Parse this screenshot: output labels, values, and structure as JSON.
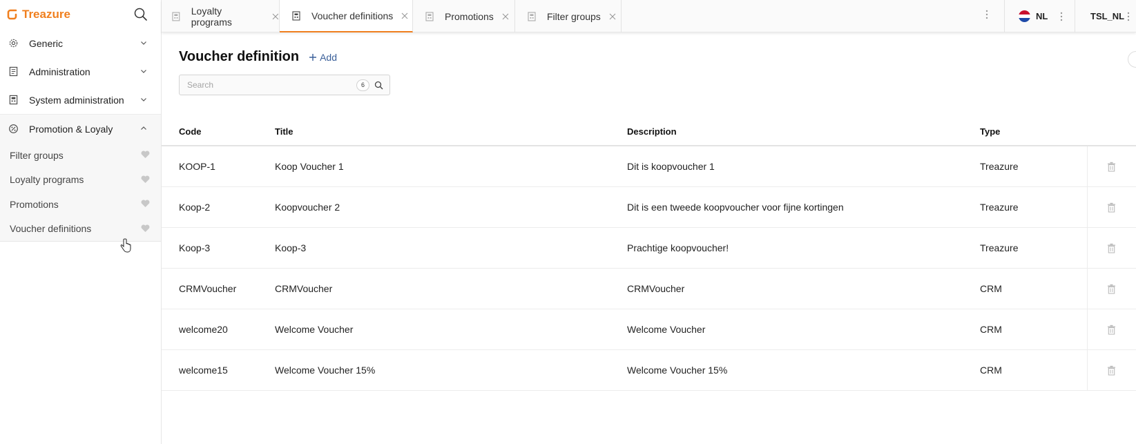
{
  "brand": {
    "name": "Treazure",
    "color": "#f07f1e"
  },
  "sidebar": {
    "items": [
      {
        "label": "Generic",
        "icon": "gear-icon"
      },
      {
        "label": "Administration",
        "icon": "document-icon"
      },
      {
        "label": "System administration",
        "icon": "calculator-icon"
      },
      {
        "label": "Promotion & Loyaly",
        "icon": "percent-badge-icon"
      }
    ],
    "subitems": [
      {
        "label": "Filter groups"
      },
      {
        "label": "Loyalty programs"
      },
      {
        "label": "Promotions"
      },
      {
        "label": "Voucher definitions"
      }
    ]
  },
  "tabs": [
    {
      "label": "Loyalty programs",
      "active": false
    },
    {
      "label": "Voucher definitions",
      "active": true
    },
    {
      "label": "Promotions",
      "active": false
    },
    {
      "label": "Filter groups",
      "active": false
    }
  ],
  "header": {
    "language": "NL",
    "user": "TSL_NL"
  },
  "main": {
    "title": "Voucher definition",
    "add_label": "Add",
    "search": {
      "placeholder": "Search",
      "value": "",
      "count": "6"
    },
    "table": {
      "columns": [
        "Code",
        "Title",
        "Description",
        "Type"
      ],
      "rows": [
        {
          "code": "KOOP-1",
          "title": "Koop Voucher 1",
          "description": "Dit is koopvoucher 1",
          "type": "Treazure"
        },
        {
          "code": "Koop-2",
          "title": "Koopvoucher 2",
          "description": "Dit is een tweede koopvoucher voor fijne kortingen",
          "type": "Treazure"
        },
        {
          "code": "Koop-3",
          "title": "Koop-3",
          "description": "Prachtige koopvoucher!",
          "type": "Treazure"
        },
        {
          "code": "CRMVoucher",
          "title": "CRMVoucher",
          "description": "CRMVoucher",
          "type": "CRM"
        },
        {
          "code": "welcome20",
          "title": "Welcome Voucher",
          "description": "Welcome Voucher",
          "type": "CRM"
        },
        {
          "code": "welcome15",
          "title": "Welcome Voucher 15%",
          "description": "Welcome Voucher 15%",
          "type": "CRM"
        }
      ]
    }
  },
  "colors": {
    "accent": "#f07f1e",
    "link": "#3a5f99"
  }
}
